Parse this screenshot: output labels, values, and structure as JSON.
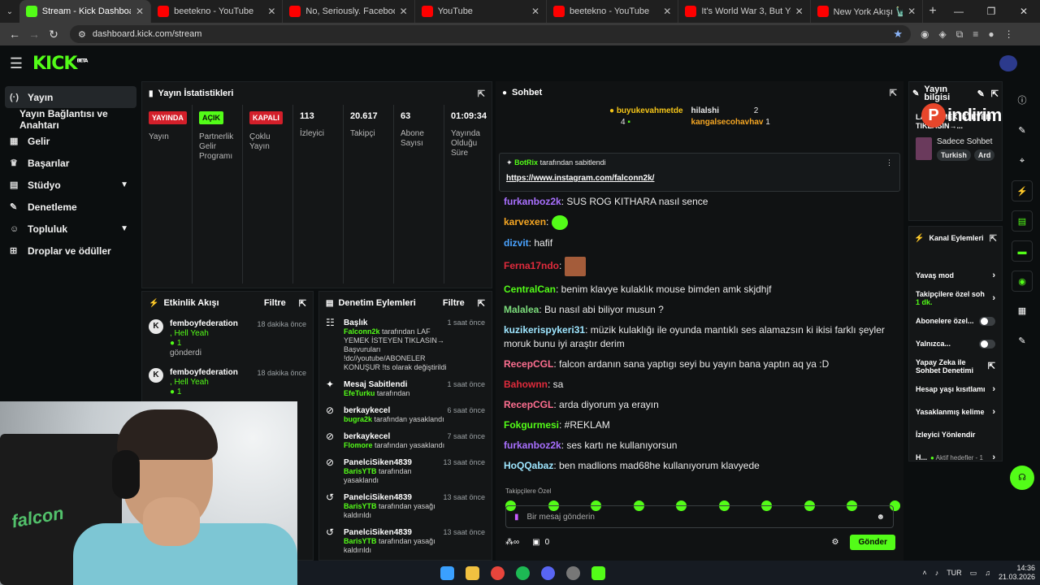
{
  "browser": {
    "tabs": [
      {
        "title": "Stream - Kick Dashboard",
        "icon": "kick-icon",
        "active": true
      },
      {
        "title": "beetekno - YouTube",
        "icon": "youtube-icon"
      },
      {
        "title": "No, Seriously. Facebook's New",
        "icon": "youtube-icon"
      },
      {
        "title": "YouTube",
        "icon": "youtube-icon"
      },
      {
        "title": "beetekno - YouTube",
        "icon": "youtube-icon"
      },
      {
        "title": "It's World War 3, But You're Ge",
        "icon": "youtube-icon"
      },
      {
        "title": "New York Akışı 🗽 Yaratıcı İş Gı",
        "icon": "youtube-icon"
      }
    ],
    "url": "dashboard.kick.com/stream"
  },
  "header": {
    "logo": "KICK",
    "logo_sup": "BETA"
  },
  "sidebar": {
    "items": [
      {
        "label": "Yayın",
        "icon": "(·)"
      },
      {
        "label": "Yayın Bağlantısı ve Anahtarı",
        "icon": ""
      },
      {
        "label": "Gelir",
        "icon": "▦"
      },
      {
        "label": "Başarılar",
        "icon": "🏆"
      },
      {
        "label": "Stüdyo",
        "icon": "▤"
      },
      {
        "label": "Denetleme",
        "icon": "✎"
      },
      {
        "label": "Topluluk",
        "icon": "👥"
      },
      {
        "label": "Droplar ve ödüller",
        "icon": "⊞"
      }
    ]
  },
  "stats": {
    "title": "Yayın İstatistikleri",
    "items": [
      {
        "badge": "YAYINDA",
        "badge_color": "#d31f2a",
        "label": "Yayın"
      },
      {
        "badge": "AÇIK",
        "badge_color": "#53fc18",
        "label": "Partnerlik Gelir Programı"
      },
      {
        "badge": "KAPALI",
        "badge_color": "#d31f2a",
        "label": "Çoklu Yayın"
      },
      {
        "value": "113",
        "label": "İzleyici"
      },
      {
        "value": "20.617",
        "label": "Takipçi"
      },
      {
        "value": "63",
        "label": "Abone Sayısı"
      },
      {
        "value": "01:09:34",
        "label": "Yayında Olduğu Süre"
      }
    ]
  },
  "activity": {
    "title": "Etkinlik Akışı",
    "filter": "Filtre",
    "items": [
      {
        "name": "femboyfederation",
        "sub": ", Hell Yeah",
        "count": "1",
        "note": "gönderdi",
        "time": "18 dakika önce"
      },
      {
        "name": "femboyfederation",
        "sub": ", Hell Yeah",
        "count": "1",
        "time": "18 dakika önce"
      }
    ]
  },
  "moderation": {
    "title": "Denetim Eylemleri",
    "filter": "Filtre",
    "items": [
      {
        "icon": "user-icon",
        "title": "Başlık",
        "time": "1 saat önce",
        "actor": "Falconn2k",
        "text": "tarafından LAF YEMEK İSTEYEN TIKLASIN→ Başvuruları !dc//youtube/ABONELER KONUŞUR !ts olarak değiştirildi"
      },
      {
        "icon": "pin-icon",
        "title": "Mesaj Sabitlendi",
        "time": "1 saat önce",
        "actor": "EfeTurku",
        "text": "tarafından"
      },
      {
        "icon": "ban-icon",
        "title": "berkaykecel",
        "time": "6 saat önce",
        "actor": "bugra2k",
        "text": "tarafından yasaklandı"
      },
      {
        "icon": "ban-icon",
        "title": "berkaykecel",
        "time": "7 saat önce",
        "actor": "Flomore",
        "text": "tarafından yasaklandı"
      },
      {
        "icon": "ban-icon",
        "title": "PanelciSiken4839",
        "time": "13 saat önce",
        "actor": "BarisYTB",
        "text": "tarafından yasaklandı"
      },
      {
        "icon": "unban-icon",
        "title": "PanelciSiken4839",
        "time": "13 saat önce",
        "actor": "BarisYTB",
        "text": "tarafından yasağı kaldırıldı"
      },
      {
        "icon": "unban-icon",
        "title": "PanelciSiken4839",
        "time": "13 saat önce",
        "actor": "BarisYTB",
        "text": "tarafından yasağı kaldırıldı"
      }
    ]
  },
  "chat": {
    "title": "Sohbet",
    "gifters": [
      {
        "name": "buyukevahmetde",
        "count": "4"
      },
      {
        "name": "hilalshi",
        "count": "2"
      },
      {
        "name": "kangalsecohavhav",
        "count": "1"
      }
    ],
    "pinned_by": "BotRix",
    "pinned_suffix": "tarafından sabitlendi",
    "pinned_link": "https://www.instagram.com/falconn2k/",
    "messages": [
      {
        "user": "furkanboz2k",
        "color": "#a970ff",
        "text": ": SUS ROG KITHARA nasıl sence"
      },
      {
        "user": "karvexen",
        "color": "#f5a623",
        "text": ":",
        "emote": "green"
      },
      {
        "user": "dizvit",
        "color": "#4aa3ff",
        "text": ": hafif"
      },
      {
        "user": "Ferna17ndo",
        "color": "#e02b3c",
        "text": ":",
        "emote": "face"
      },
      {
        "user": "CentralCan",
        "color": "#53fc18",
        "text": ": benim klavye kulaklık mouse bimden amk skjdhjf"
      },
      {
        "user": "Malalea",
        "color": "#7cdd7c",
        "text": ": Bu nasıl abi biliyor musun ?"
      },
      {
        "user": "kuzikerispykeri31",
        "color": "#9ee6ff",
        "text": ": müzik kulaklığı ile oyunda mantıklı ses alamazsın ki ikisi farklı şeyler moruk bunu iyi araştır derim"
      },
      {
        "user": "RecepCGL",
        "color": "#ff6f91",
        "text": ": falcon ardanın sana yaptıgı seyi bu yayın bana yaptın aq ya :D"
      },
      {
        "user": "Bahownn",
        "color": "#e02b3c",
        "text": ": sa"
      },
      {
        "user": "RecepCGL",
        "color": "#ff6f91",
        "text": ": arda diyorum ya erayın"
      },
      {
        "user": "Fokgurmesi",
        "color": "#53fc18",
        "text": ": #REKLAM"
      },
      {
        "user": "furkanboz2k",
        "color": "#a970ff",
        "text": ": ses kartı ne kullanıyorsun"
      },
      {
        "user": "HoQQabaz",
        "color": "#9ee6ff",
        "text": ": ben madlions mad68he kullanıyorum klavyede"
      }
    ],
    "emote_label": "Takipçilere Özel",
    "input_placeholder": "Bir mesaj gönderin",
    "points": "0",
    "send_label": "Gönder"
  },
  "stream_info": {
    "title": "Yayın bilgisi",
    "stream_title": "LAF YEMEK İSTEYEN TIKLASIN→...",
    "category": "Sadece Sohbet",
    "tags": [
      "Turkish",
      "Ard"
    ]
  },
  "overlay": {
    "brand": "indirim"
  },
  "channel_actions": {
    "title": "Kanal Eylemleri",
    "items": [
      {
        "label": "Yavaş mod",
        "control": "chevron"
      },
      {
        "label": "Takipçilere özel soh",
        "sub": "1 dk.",
        "control": "chevron"
      },
      {
        "label": "Abonelere özel...",
        "control": "toggle"
      },
      {
        "label": "Yalnızca...",
        "control": "toggle"
      },
      {
        "label": "Yapay Zeka ile Sohbet Denetimi",
        "control": "external"
      },
      {
        "label": "Hesap yaşı kısıtlamı",
        "control": "chevron"
      },
      {
        "label": "Yasaklanmış kelime",
        "control": "chevron"
      },
      {
        "label": "İzleyici Yönlendir",
        "control": "none"
      },
      {
        "label": "H...",
        "sub": "Aktif hedefler - 1",
        "control": "chevron"
      }
    ]
  },
  "webcam": {
    "watermark": "falcon"
  },
  "taskbar": {
    "lang": "TUR",
    "time": "14:36",
    "date": "21.03.2026"
  }
}
